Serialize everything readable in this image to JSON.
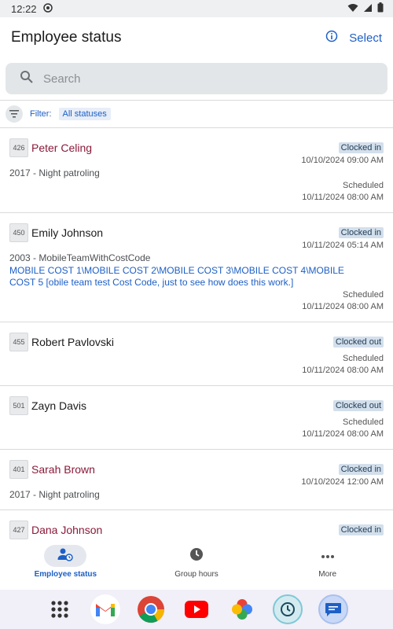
{
  "status_bar": {
    "time": "12:22"
  },
  "header": {
    "title": "Employee status",
    "select_label": "Select"
  },
  "search": {
    "placeholder": "Search"
  },
  "filter": {
    "label": "Filter:",
    "chip": "All statuses"
  },
  "employees": [
    {
      "id": "426",
      "name": "Peter Celing",
      "status": "Clocked in",
      "status_time": "10/10/2024 09:00 AM",
      "team": "2017 - Night patroling",
      "scheduled_label": "Scheduled",
      "scheduled_time": "10/11/2024 08:00 AM"
    },
    {
      "id": "450",
      "name": "Emily Johnson",
      "status": "Clocked in",
      "status_time": "10/11/2024 05:14 AM",
      "team": "2003 - MobileTeamWithCostCode",
      "cost_code": "MOBILE COST 1\\MOBILE COST 2\\MOBILE COST 3\\MOBILE COST 4\\MOBILE COST 5 [obile team test Cost Code, just to see how does this work.]",
      "scheduled_label": "Scheduled",
      "scheduled_time": "10/11/2024 08:00 AM"
    },
    {
      "id": "455",
      "name": "Robert Pavlovski",
      "status": "Clocked out",
      "scheduled_label": "Scheduled",
      "scheduled_time": "10/11/2024 08:00 AM"
    },
    {
      "id": "501",
      "name": "Zayn Davis",
      "status": "Clocked out",
      "scheduled_label": "Scheduled",
      "scheduled_time": "10/11/2024 08:00 AM"
    },
    {
      "id": "401",
      "name": "Sarah Brown",
      "status": "Clocked in",
      "status_time": "10/10/2024 12:00 AM",
      "team": "2017 - Night patroling"
    },
    {
      "id": "427",
      "name": "Dana Johnson",
      "status": "Clocked in"
    }
  ],
  "bottom_nav": [
    {
      "label": "Employee status",
      "icon": "person-clock-icon",
      "active": true
    },
    {
      "label": "Group hours",
      "icon": "clock-icon",
      "active": false
    },
    {
      "label": "More",
      "icon": "more-dots-icon",
      "active": false
    }
  ],
  "dock_apps": [
    "app-grid-icon",
    "gmail-icon",
    "chrome-icon",
    "youtube-icon",
    "photos-icon",
    "timeclock-app-icon",
    "messages-icon"
  ],
  "colors": {
    "accent": "#1d5fc6",
    "name_red": "#8a1a3a",
    "badge_bg": "#d3dfeb"
  }
}
